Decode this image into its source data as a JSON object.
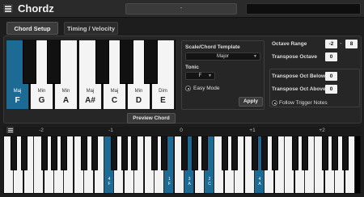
{
  "app": {
    "title": "Chordz",
    "preset": "-"
  },
  "tabs": [
    {
      "label": "Chord Setup",
      "active": true
    },
    {
      "label": "Timing / Velocity",
      "active": false
    }
  ],
  "chord_keys": [
    {
      "type": "Maj",
      "note": "F",
      "selected": true
    },
    {
      "type": "Min",
      "note": "G",
      "selected": false
    },
    {
      "type": "Min",
      "note": "A",
      "selected": false
    },
    {
      "type": "Maj",
      "note": "A#",
      "selected": false
    },
    {
      "type": "Maj",
      "note": "C",
      "selected": false
    },
    {
      "type": "Min",
      "note": "D",
      "selected": false
    },
    {
      "type": "Dim",
      "note": "E",
      "selected": false
    }
  ],
  "preview_label": "Preview Chord",
  "template": {
    "heading": "Scale/Chord Template",
    "scale": "Major",
    "tonic_label": "Tonic",
    "tonic": "F",
    "easy_mode_label": "Easy Mode",
    "apply_label": "Apply"
  },
  "octave": {
    "range_label": "Octave Range",
    "range_low": "-2",
    "range_sep": "-",
    "range_high": "8",
    "transpose_label": "Transpose Octave",
    "transpose_value": "0",
    "below_label": "Transpose Oct Below",
    "below_value": "0",
    "above_label": "Transpose Oct Above",
    "above_value": "0",
    "follow_label": "Follow Trigger Notes"
  },
  "keyboard": {
    "octave_labels": [
      "-2",
      "-1",
      "0",
      "+1",
      "+2"
    ],
    "highlighted": [
      {
        "index": 10,
        "line1": "4",
        "line2": "F"
      },
      {
        "index": 16,
        "line1": "1",
        "line2": "F"
      },
      {
        "index": 18,
        "line1": "3",
        "line2": "A"
      },
      {
        "index": 20,
        "line1": "2",
        "line2": "C"
      },
      {
        "index": 25,
        "line1": "4",
        "line2": "A"
      }
    ]
  },
  "colors": {
    "accent": "#1c6b94",
    "background": "#1d1d1d",
    "panel": "#262626"
  },
  "icons": {
    "menu": "hamburger-menu-icon",
    "keyboard_menu": "hamburger-menu-icon"
  }
}
